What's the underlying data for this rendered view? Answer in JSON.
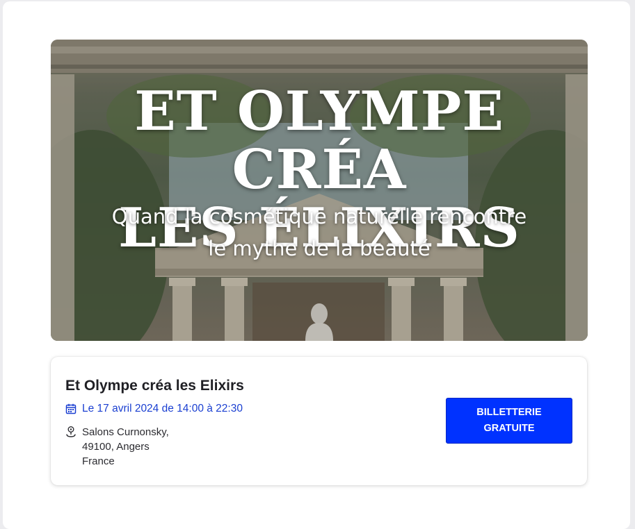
{
  "banner": {
    "title_line1": "ET OLYMPE CRÉA",
    "title_line2": "LES ÉLIXIRS",
    "subtitle_line1": "Quand la cosmétique naturelle rencontre",
    "subtitle_line2": "le mythe de la beauté"
  },
  "event": {
    "title": "Et Olympe créa les Elixirs",
    "date_text": "Le 17 avril 2024 de 14:00 à 22:30",
    "location": {
      "line1": "Salons Curnonsky,",
      "line2": "49100, Angers",
      "line3": "France"
    },
    "ticket_button": {
      "line1": "BILLETTERIE",
      "line2": "GRATUITE"
    }
  },
  "icons": {
    "date": "calendar-icon",
    "location": "map-pin-icon"
  },
  "colors": {
    "accent_button": "#0032ff",
    "date_text": "#1a3fd1",
    "title_text": "#1f1f24"
  }
}
